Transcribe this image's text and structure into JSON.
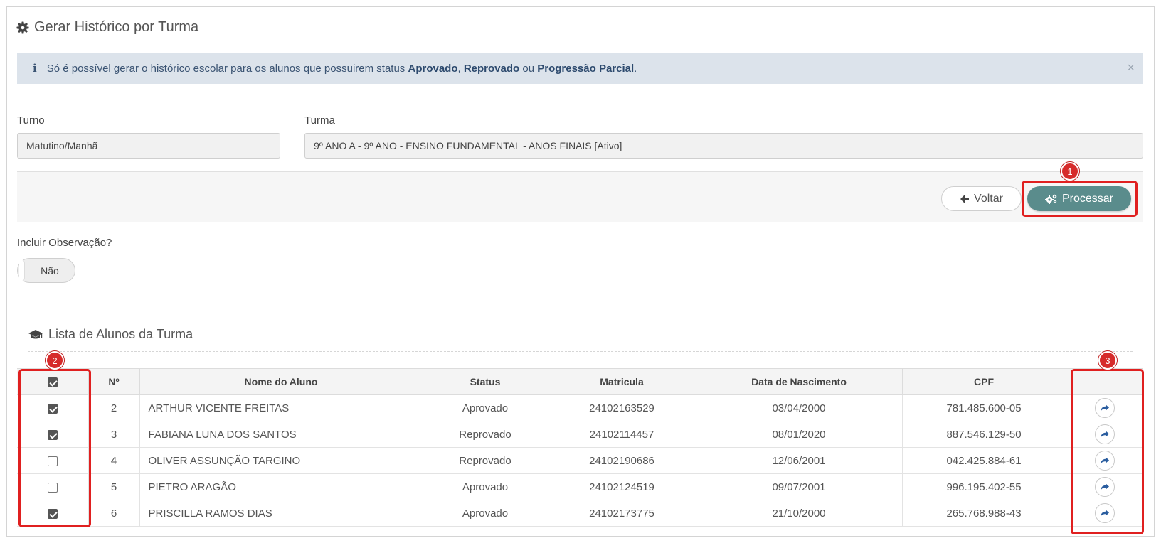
{
  "page": {
    "title": "Gerar Histórico por Turma"
  },
  "alert": {
    "text_before": "Só é possível gerar o histórico escolar para os alunos que possuirem status ",
    "status1": "Aprovado",
    "sep1": ", ",
    "status2": "Reprovado",
    "sep2": " ou ",
    "status3": "Progressão Parcial",
    "end": ".",
    "close": "×"
  },
  "form": {
    "turno_label": "Turno",
    "turno_value": "Matutino/Manhã",
    "turma_label": "Turma",
    "turma_value": "9º ANO A - 9º ANO - ENSINO FUNDAMENTAL - ANOS FINAIS [Ativo]"
  },
  "actions": {
    "voltar_label": "Voltar",
    "processar_label": "Processar"
  },
  "observacao": {
    "label": "Incluir Observação?",
    "toggle_value": "Não"
  },
  "list": {
    "title": "Lista de Alunos da Turma",
    "columns": [
      "Nº",
      "Nome do Aluno",
      "Status",
      "Matricula",
      "Data de Nascimento",
      "CPF"
    ],
    "header_checked": true,
    "rows": [
      {
        "checked": true,
        "n": "2",
        "name": "ARTHUR VICENTE FREITAS",
        "status": "Aprovado",
        "matricula": "24102163529",
        "nascimento": "03/04/2000",
        "cpf": "781.485.600-05"
      },
      {
        "checked": true,
        "n": "3",
        "name": "FABIANA LUNA DOS SANTOS",
        "status": "Reprovado",
        "matricula": "24102114457",
        "nascimento": "08/01/2020",
        "cpf": "887.546.129-50"
      },
      {
        "checked": false,
        "n": "4",
        "name": "OLIVER ASSUNÇÃO TARGINO",
        "status": "Reprovado",
        "matricula": "24102190686",
        "nascimento": "12/06/2001",
        "cpf": "042.425.884-61"
      },
      {
        "checked": false,
        "n": "5",
        "name": "PIETRO ARAGÃO",
        "status": "Aprovado",
        "matricula": "24102124519",
        "nascimento": "09/07/2001",
        "cpf": "996.195.402-55"
      },
      {
        "checked": true,
        "n": "6",
        "name": "PRISCILLA RAMOS DIAS",
        "status": "Aprovado",
        "matricula": "24102173775",
        "nascimento": "21/10/2000",
        "cpf": "265.768.988-43"
      }
    ]
  },
  "annotations": {
    "marker1": "1",
    "marker2": "2",
    "marker3": "3"
  },
  "colors": {
    "processar_button": "#5a8c8c",
    "alert_background": "#dce3eb",
    "highlight": "#e02020"
  },
  "icons": [
    "cog-icon",
    "info-icon",
    "close-icon",
    "arrow-left-icon",
    "cogs-icon",
    "graduation-cap-icon",
    "share-arrow-icon"
  ]
}
